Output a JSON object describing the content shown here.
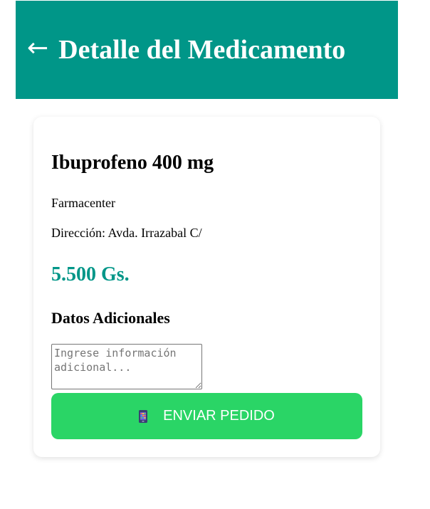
{
  "header": {
    "back_arrow": "←",
    "title": "Detalle del Medicamento",
    "background_color": "#009688"
  },
  "product": {
    "name": "Ibuprofeno 400 mg",
    "pharmacy": "Farmacenter",
    "address": "Dirección: Avda. Irrazabal C/",
    "price": "5.500 Gs.",
    "price_color": "#009688"
  },
  "additional": {
    "title": "Datos Adicionales",
    "placeholder": "Ingrese información adicional...",
    "value": ""
  },
  "send_button": {
    "icon": "mobile-phone-icon",
    "label": "ENVIAR PEDIDO",
    "color": "#2ad566"
  }
}
